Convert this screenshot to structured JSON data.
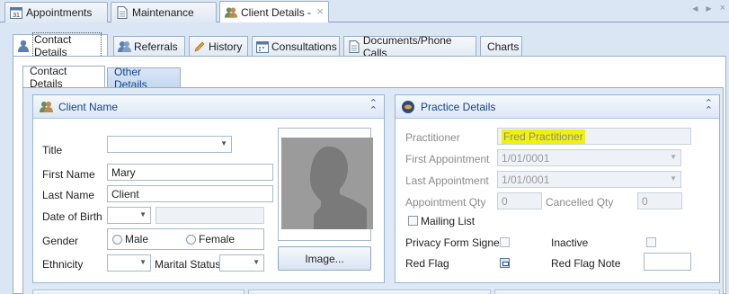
{
  "doc_tabs": [
    {
      "label": "Appointments",
      "icon": "calendar-icon"
    },
    {
      "label": "Maintenance",
      "icon": "document-icon"
    },
    {
      "label": "Client Details -",
      "icon": "clients-icon"
    }
  ],
  "sub_tabs": [
    {
      "label": "Contact Details",
      "icon": "contact-icon"
    },
    {
      "label": "Referrals",
      "icon": "referral-icon"
    },
    {
      "label": "History",
      "icon": "pencil-icon"
    },
    {
      "label": "Consultations",
      "icon": "calendar-icon"
    },
    {
      "label": "Documents/Phone Calls",
      "icon": "document-icon"
    },
    {
      "label": "Charts",
      "icon": ""
    }
  ],
  "inner_tabs": [
    {
      "label": "Contact Details"
    },
    {
      "label": "Other Details"
    }
  ],
  "client_panel": {
    "title": "Client Name",
    "title_label": "Title",
    "title_value": "",
    "first_name_label": "First Name",
    "first_name_value": "Mary",
    "last_name_label": "Last Name",
    "last_name_value": "Client",
    "dob_label": "Date of Birth",
    "dob_value": "",
    "gender_label": "Gender",
    "gender_male": "Male",
    "gender_female": "Female",
    "ethnicity_label": "Ethnicity",
    "ethnicity_value": "",
    "marital_label": "Marital Status",
    "marital_value": "",
    "image_button": "Image..."
  },
  "practice_panel": {
    "title": "Practice Details",
    "practitioner_label": "Practitioner",
    "practitioner_value": "Fred Practitioner",
    "first_appt_label": "First Appointment",
    "first_appt_value": "1/01/0001",
    "last_appt_label": "Last Appointment",
    "last_appt_value": "1/01/0001",
    "appt_qty_label": "Appointment Qty",
    "appt_qty_value": "0",
    "cancelled_qty_label": "Cancelled Qty",
    "cancelled_qty_value": "0",
    "mailing_list_label": "Mailing List",
    "privacy_label": "Privacy Form Signed",
    "inactive_label": "Inactive",
    "red_flag_label": "Red Flag",
    "red_flag_note_label": "Red Flag Note",
    "red_flag_note_value": ""
  },
  "colors": {
    "highlight": "#f0f20a",
    "panel_title": "#15428b",
    "background": "#dbe6f4"
  }
}
